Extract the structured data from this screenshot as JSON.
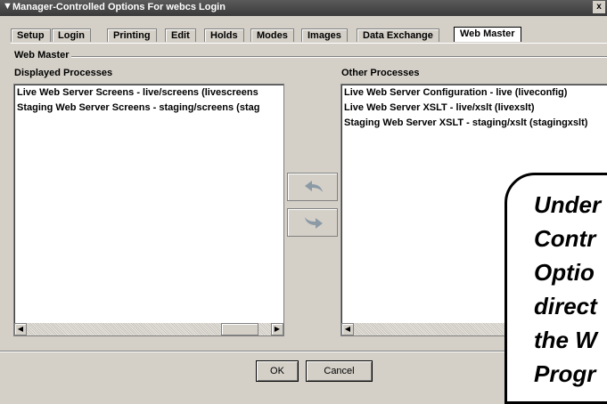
{
  "window": {
    "title": "Manager-Controlled Options For webcs Login",
    "close_label": "x"
  },
  "tabs": [
    {
      "label": "Setup"
    },
    {
      "label": "Login"
    },
    {
      "label": "Printing"
    },
    {
      "label": "Edit"
    },
    {
      "label": "Holds"
    },
    {
      "label": "Modes"
    },
    {
      "label": "Images"
    },
    {
      "label": "Data Exchange"
    },
    {
      "label": "Web Master",
      "active": true
    }
  ],
  "group": {
    "label": "Web Master"
  },
  "displayed": {
    "label": "Displayed Processes",
    "items": [
      "Live Web Server Screens - live/screens (livescreens",
      "Staging Web Server Screens - staging/screens (stag"
    ]
  },
  "other": {
    "label": "Other Processes",
    "items": [
      "Live Web Server Configuration - live (liveconfig)",
      "Live Web Server XSLT - live/xslt (livexslt)",
      "Staging Web Server XSLT - staging/xslt (stagingxslt)"
    ]
  },
  "buttons": {
    "ok": "OK",
    "cancel": "Cancel"
  },
  "callout": {
    "lines": [
      "Under",
      "Contr",
      "Optio",
      "direct",
      "the W",
      "Progr"
    ]
  }
}
